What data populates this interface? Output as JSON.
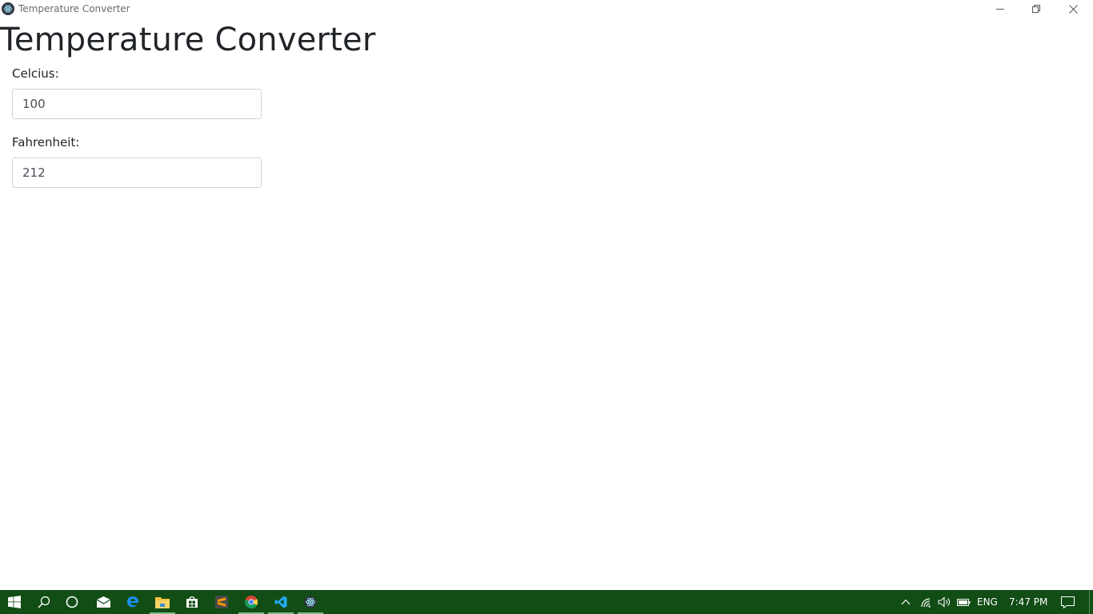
{
  "window": {
    "title": "Temperature Converter",
    "icon": "electron-atom-icon",
    "controls": [
      "minimize-icon",
      "restore-icon",
      "close-icon"
    ]
  },
  "main": {
    "heading": "Temperature Converter",
    "celcius": {
      "label": "Celcius:",
      "value": "100"
    },
    "fahrenheit": {
      "label": "Fahrenheit:",
      "value": "212"
    }
  },
  "taskbar": {
    "color": "#114d15",
    "apps": [
      "windows-start-icon",
      "search-icon",
      "cortana-icon",
      "mail-icon",
      "edge-icon",
      "file-explorer-icon",
      "store-icon",
      "sublime-text-icon",
      "chrome-icon",
      "vscode-icon",
      "electron-app-icon"
    ],
    "tray": {
      "language": "ENG",
      "time": "7:47 PM"
    }
  }
}
